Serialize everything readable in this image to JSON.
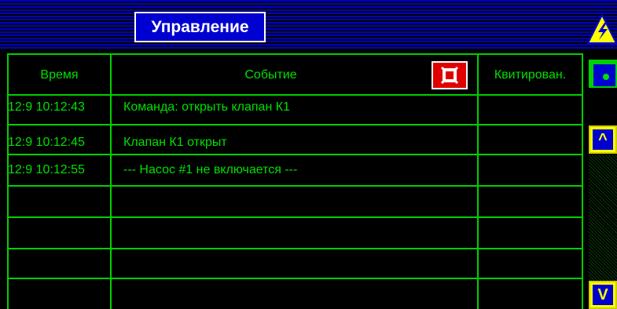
{
  "header": {
    "title": "Управление"
  },
  "table": {
    "columns": [
      "Время",
      "Событие",
      "Квитирован."
    ],
    "rows": [
      {
        "time": "12:9 10:12:43",
        "event": "Команда: открыть клапан К1",
        "ack": ""
      },
      {
        "time": "12:9 10:12:45",
        "event": "Клапан К1 открыт",
        "ack": ""
      },
      {
        "time": "12:9 10:12:55",
        "event": "--- Насос #1 не включается ---",
        "ack": ""
      },
      {
        "time": "",
        "event": "",
        "ack": ""
      },
      {
        "time": "",
        "event": "",
        "ack": ""
      },
      {
        "time": "",
        "event": "",
        "ack": ""
      },
      {
        "time": "",
        "event": "",
        "ack": ""
      }
    ]
  },
  "controls": {
    "scroll_up_symbol": "^",
    "scroll_down_symbol": "V"
  },
  "colors": {
    "grid": "#00d000",
    "text": "#00e000",
    "title_bg": "#0000d0",
    "alarm": "#ffff00",
    "clear_button": "#e00000"
  },
  "icons": [
    "alarm-lightning-icon",
    "clear-events-icon",
    "acknowledge-dot-icon"
  ]
}
